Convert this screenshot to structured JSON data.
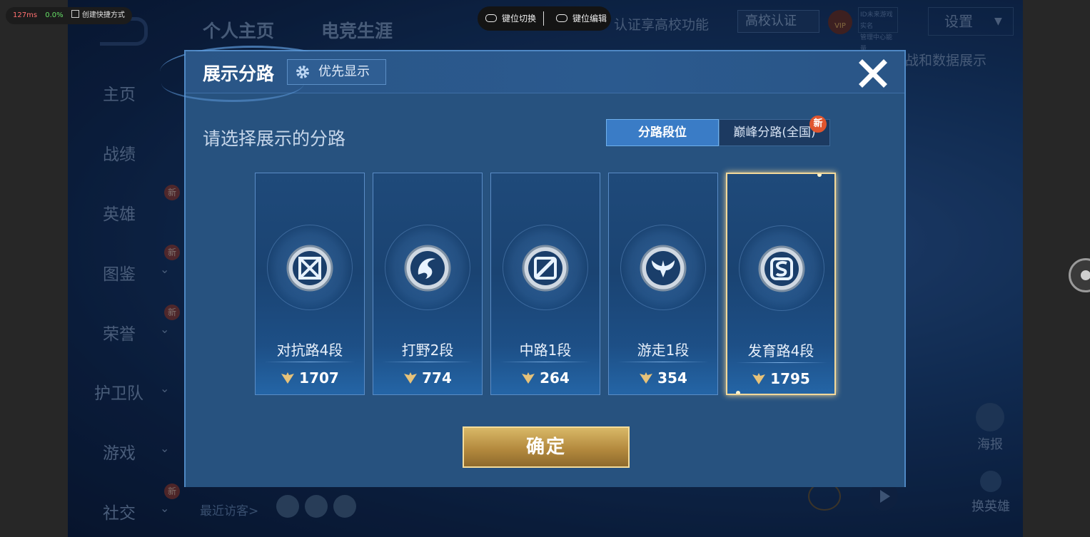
{
  "overlay": {
    "latency": "127ms",
    "cpu": "0.0%",
    "shortcut_label": "创建快捷方式",
    "key_switch_label": "键位切换",
    "key_edit_label": "键位编辑"
  },
  "background": {
    "top_tabs": [
      "个人主页",
      "电竞生涯"
    ],
    "cert_text": "认证享高校功能",
    "cert_button": "高校认证",
    "vip_label": "VIP",
    "micro_lines": [
      "ID未来游戏实名",
      "管理中心能量"
    ],
    "settings_label": "设置",
    "behind_text": "战和数据展示",
    "sidebar": [
      {
        "label": "主页",
        "chevron": false,
        "new": false
      },
      {
        "label": "战绩",
        "chevron": false,
        "new": false
      },
      {
        "label": "英雄",
        "chevron": false,
        "new": true
      },
      {
        "label": "图鉴",
        "chevron": true,
        "new": true
      },
      {
        "label": "荣誉",
        "chevron": true,
        "new": true
      },
      {
        "label": "护卫队",
        "chevron": true,
        "new": false
      },
      {
        "label": "游戏",
        "chevron": true,
        "new": false
      },
      {
        "label": "社交",
        "chevron": true,
        "new": true
      }
    ],
    "new_badge": "新",
    "recent_visitors": "最近访客>",
    "poster_label": "海报",
    "swap_hero_label": "换英雄"
  },
  "modal": {
    "title": "展示分路",
    "priority_button": "优先显示",
    "subtitle": "请选择展示的分路",
    "segments": [
      {
        "label": "分路段位",
        "active": true
      },
      {
        "label": "巅峰分路(全国)",
        "active": false,
        "badge": "新"
      }
    ],
    "lanes": [
      {
        "name": "对抗路4段",
        "score": "1707",
        "icon": "clash-lane-icon",
        "selected": false
      },
      {
        "name": "打野2段",
        "score": "774",
        "icon": "jungle-icon",
        "selected": false
      },
      {
        "name": "中路1段",
        "score": "264",
        "icon": "mid-lane-icon",
        "selected": false
      },
      {
        "name": "游走1段",
        "score": "354",
        "icon": "roam-icon",
        "selected": false
      },
      {
        "name": "发育路4段",
        "score": "1795",
        "icon": "farm-lane-icon",
        "selected": true
      }
    ],
    "confirm_label": "确定",
    "colors": {
      "accent": "#3a7cc6",
      "selected_border": "#f2d89a",
      "confirm_gold": "#c9a458"
    }
  }
}
